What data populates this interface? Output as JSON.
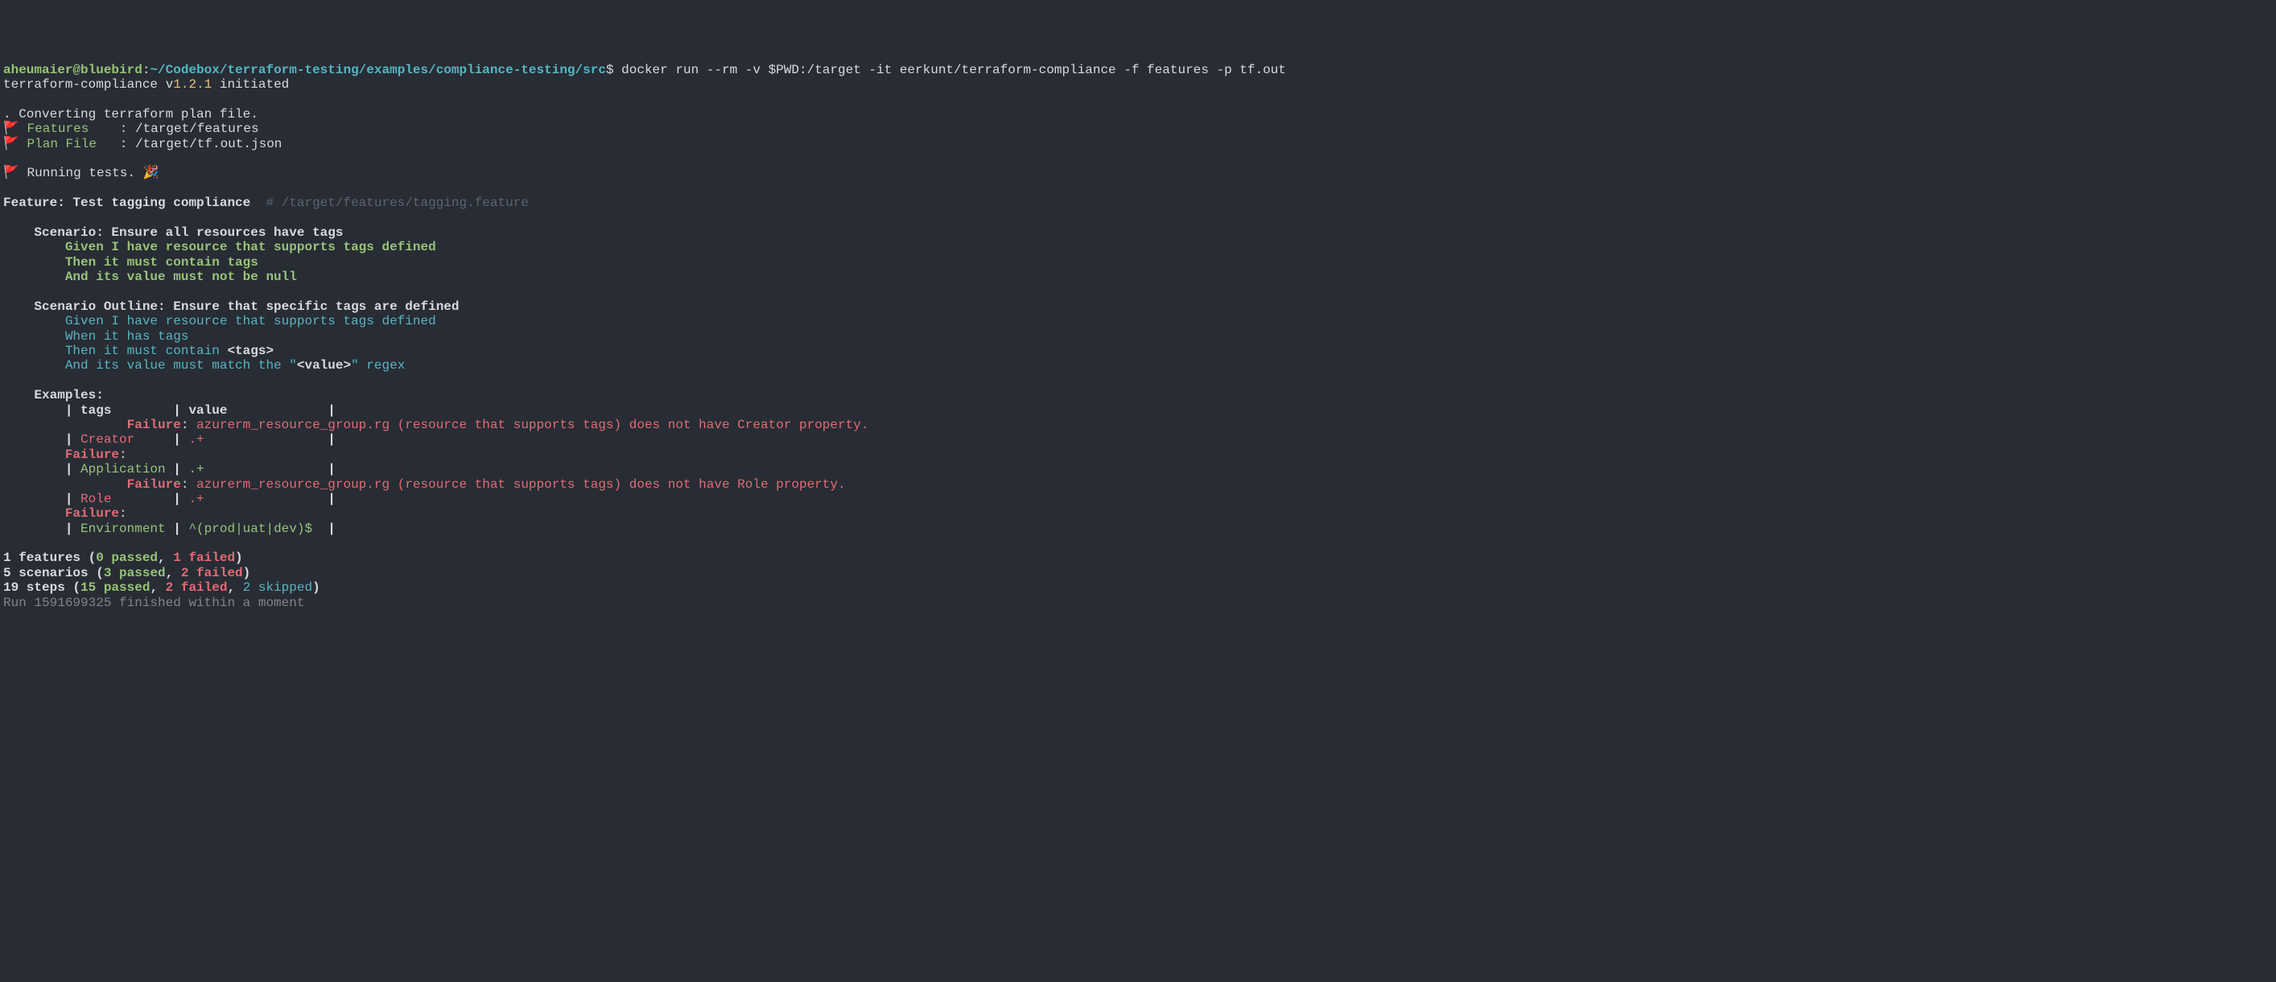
{
  "prompt": {
    "user_host": "aheumaier@bluebird",
    "colon": ":",
    "path": "~/Codebox/terraform-testing/examples/compliance-testing/src",
    "dollar": "$",
    "command": " docker run --rm -v $PWD:/target -it eerkunt/terraform-compliance -f features -p tf.out"
  },
  "initiated": {
    "prefix": "terraform-compliance v",
    "version": "1.2.1",
    "suffix": " initiated"
  },
  "blank1": "",
  "converting": ". Converting terraform plan file.",
  "features_line": {
    "flag": "🚩",
    "label": " Features    ",
    "colon": ":",
    "value": " /target/features"
  },
  "planfile_line": {
    "flag": "🚩",
    "label": " Plan File   ",
    "colon": ":",
    "value": " /target/tf.out.json"
  },
  "blank2": "",
  "running_line": {
    "flag": "🚩",
    "text": " Running tests. ",
    "party": "🎉"
  },
  "blank3": "",
  "feature_header": {
    "text": "Feature: Test tagging compliance  ",
    "hash": "# ",
    "path": "/target/features/tagging.feature"
  },
  "blank4": "",
  "scenario1": {
    "title": "    Scenario: Ensure all resources have tags",
    "given": "        Given I have resource that supports tags defined",
    "then": "        Then it must contain tags",
    "and": "        And its value must not be null"
  },
  "blank5": "",
  "scenario2": {
    "title": "    Scenario Outline: Ensure that specific tags are defined",
    "given": "        Given I have resource that supports tags defined",
    "when": "        When it has tags",
    "then_prefix": "        Then it must contain ",
    "then_tag": "<tags>",
    "and_prefix": "        And its value must match the \"",
    "and_tag": "<value>",
    "and_suffix": "\" regex"
  },
  "blank6": "",
  "examples_header": "    Examples:",
  "table": {
    "header": {
      "pipe1": "        | ",
      "col1": "tags",
      "pipe2": "        | ",
      "col2": "value",
      "pipe3": "             |"
    },
    "fail1": {
      "indent": "                ",
      "label": "Failure",
      "colon": ": ",
      "msg": "azurerm_resource_group.rg (resource that supports tags) does not have Creator property."
    },
    "row1": {
      "pipe1": "        | ",
      "tag": "Creator",
      "pipe2": "     | ",
      "val": ".+",
      "pipe3": "                |"
    },
    "fail2": {
      "indent": "        ",
      "label": "Failure",
      "colon": ":"
    },
    "row2": {
      "pipe1": "        | ",
      "tag": "Application",
      "pipe2": " | ",
      "val": ".+",
      "pipe3": "                |"
    },
    "fail3": {
      "indent": "                ",
      "label": "Failure",
      "colon": ": ",
      "msg": "azurerm_resource_group.rg (resource that supports tags) does not have Role property."
    },
    "row3": {
      "pipe1": "        | ",
      "tag": "Role",
      "pipe2": "        | ",
      "val": ".+",
      "pipe3": "                |"
    },
    "fail4": {
      "indent": "        ",
      "label": "Failure",
      "colon": ":"
    },
    "row4": {
      "pipe1": "        | ",
      "tag": "Environment",
      "pipe2": " | ",
      "val": "^(prod|uat|dev)$",
      "pipe3": "  |"
    }
  },
  "blank7": "",
  "summary": {
    "features": {
      "prefix": "1 features (",
      "passed": "0 passed",
      "sep1": ", ",
      "failed": "1 failed",
      "suffix": ")"
    },
    "scenarios": {
      "prefix": "5 scenarios (",
      "passed": "3 passed",
      "sep1": ", ",
      "failed": "2 failed",
      "suffix": ")"
    },
    "steps": {
      "prefix": "19 steps (",
      "passed": "15 passed",
      "sep1": ", ",
      "failed": "2 failed",
      "sep2": ", ",
      "skipped": "2 skipped",
      "suffix": ")"
    }
  },
  "run_end": "Run 1591699325 finished within a moment"
}
